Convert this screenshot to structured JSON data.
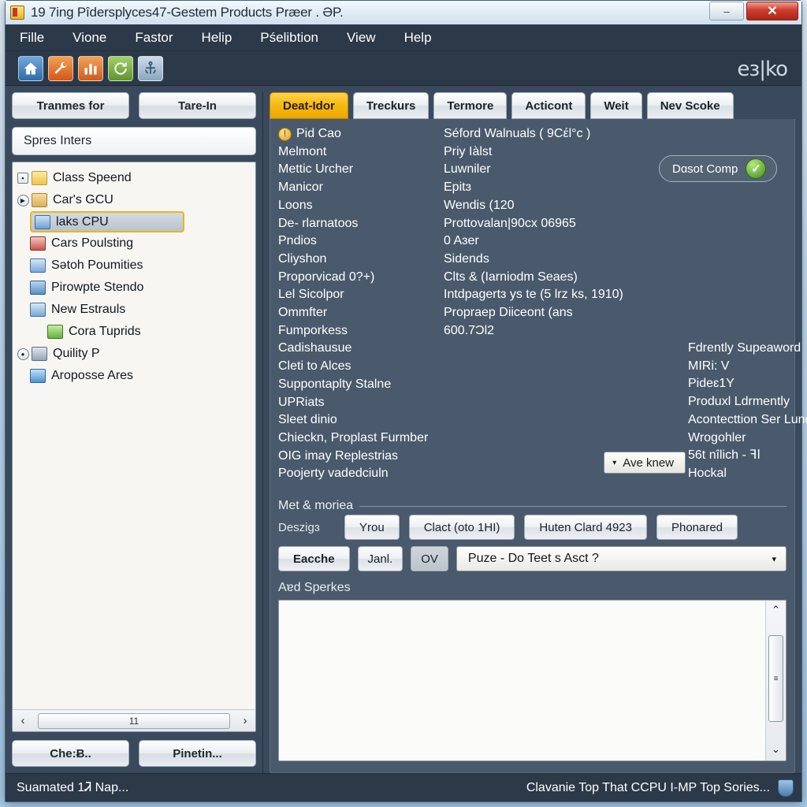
{
  "window": {
    "title": "19 7ing Pîdersplyces47-Gestem Products Præer . ƏP.",
    "minimize_label": "–",
    "maximize_label": "❐",
    "close_label": "✕"
  },
  "menubar": {
    "items": [
      {
        "label": "Fille"
      },
      {
        "label": "Vione"
      },
      {
        "label": "Fastor"
      },
      {
        "label": "Helip"
      },
      {
        "label": "Pśelibtion"
      },
      {
        "label": "View"
      },
      {
        "label": "Help"
      }
    ]
  },
  "toolbar": {
    "icons": [
      {
        "name": "home-icon",
        "glyph": "⌂"
      },
      {
        "name": "wrench-icon",
        "glyph": "🔧"
      },
      {
        "name": "chart-icon",
        "glyph": "📊"
      },
      {
        "name": "refresh-icon",
        "glyph": "↻"
      },
      {
        "name": "anchor-icon",
        "glyph": "⚓"
      }
    ],
    "brand": "eɜ|ko"
  },
  "left": {
    "top_buttons": [
      {
        "label": "Tranmes for"
      },
      {
        "label": "Tare-In"
      }
    ],
    "search": {
      "value": "Spres Inters",
      "placeholder": "Spres Inters"
    },
    "tree": [
      {
        "label": "Class Speend",
        "icon": "folder-icon",
        "twisty": "expanded",
        "indent": 0,
        "selected": false
      },
      {
        "label": "Car's GCU",
        "icon": "folder-open-icon",
        "twisty": "collapsed",
        "indent": 0,
        "selected": false
      },
      {
        "label": "laks CPU",
        "icon": "document-blue-icon",
        "twisty": "none",
        "indent": 1,
        "selected": true
      },
      {
        "label": "Cars Poulsting",
        "icon": "disc-red-icon",
        "twisty": "none",
        "indent": 1,
        "selected": false
      },
      {
        "label": "Sətoh Poumities",
        "icon": "document-blue-icon",
        "twisty": "none",
        "indent": 1,
        "selected": false
      },
      {
        "label": "Pirowpte Stendo",
        "icon": "plug-blue-icon",
        "twisty": "none",
        "indent": 1,
        "selected": false
      },
      {
        "label": "New Estrauls",
        "icon": "document-blue-icon",
        "twisty": "none",
        "indent": 1,
        "selected": false
      },
      {
        "label": "Cora Tuprids",
        "icon": "card-green-icon",
        "twisty": "none",
        "indent": 2,
        "selected": false
      },
      {
        "label": "Quility P",
        "icon": "gear-icon",
        "twisty": "radio",
        "indent": 0,
        "selected": false
      },
      {
        "label": "Aroposse Ares",
        "icon": "shield-icon",
        "twisty": "none",
        "indent": 1,
        "selected": false
      }
    ],
    "hscroll": {
      "left_arrow": "‹",
      "right_arrow": "›",
      "thumb_label": "11"
    },
    "bottom_buttons": [
      {
        "label": "Che:Ƀ.."
      },
      {
        "label": "Pinetin..."
      }
    ]
  },
  "tabs": [
    {
      "label": "Deat-Idor",
      "active": true
    },
    {
      "label": "Treckurs",
      "active": false
    },
    {
      "label": "Termore",
      "active": false
    },
    {
      "label": "Acticont",
      "active": false
    },
    {
      "label": "Weit",
      "active": false
    },
    {
      "label": "Nev Scoke",
      "active": false
    }
  ],
  "panel": {
    "column_a": [
      "Pid Cao",
      "Melmont",
      "Mettic Urcher",
      "Manicor",
      "Loons",
      "De- rlarnatoos",
      "Pndios",
      "Cliyshon",
      "Proporvicad 0?+)",
      "Lel Sicolpor",
      "Ommfter",
      "Fumporkess",
      "Cadishausue",
      "Cleti to Alces",
      "Suppontaplty Stalne",
      "UPRiats",
      "Sleet dinio",
      "Chieckn, Proplast Furmber",
      "OIG imay Replestrias",
      "Poojerty vadedciuln"
    ],
    "column_b": [
      "Séford Walnuals ( 9Cέl°c )",
      "Priy Iàlst",
      "Luwniler",
      "Epitɜ",
      "Wendis (120",
      "Prottovalan|90cx 06965",
      "0 Aɜer",
      "Sidends",
      "Clts &  (Iarniodm Seaes)",
      "Intdpagertɜ ys te (5 lrz ks, 1910)",
      "Propraep Diiceont (ans",
      "600.7ƆƖ2"
    ],
    "column_c": [
      "Fdrently Supeaword",
      "MIRi: V",
      "Pideɛ1Y",
      "Produxl Ldrmently",
      "Acontecttion Ser Lunozy",
      "Wrogohler",
      "56t nîlich - ꟻⅼ",
      "Hockal"
    ],
    "status_pill": {
      "label": "Dɑsot Comp",
      "icon": "check-circle-icon"
    },
    "inline_dropdown": {
      "label": "Ave knew",
      "caret": "▾"
    },
    "group": {
      "legend": "Met & moriea",
      "row1_label": "Deszigɜ",
      "row1_buttons": [
        {
          "label": "Yrou"
        },
        {
          "label": "Clact (oto 1HI)"
        },
        {
          "label": "Huten Clard 4923"
        },
        {
          "label": "Phonared"
        }
      ],
      "row2_buttons": [
        {
          "label": "Eacche"
        },
        {
          "label": "Janl."
        },
        {
          "label": "OV"
        }
      ],
      "combo": {
        "value": "Puze  -  Do Teet s Asct ?",
        "caret": "▾"
      }
    },
    "notes_label": "Aɐd Sperkes",
    "notes": {
      "value": "",
      "placeholder": ""
    },
    "notes_scroll": {
      "up": "⌃",
      "down": "⌄",
      "thumb": "≡"
    }
  },
  "statusbar": {
    "left": "Suamated 1Ꮨ Nap...",
    "right": "Clavanie Top That CCPU I-MP Top Sories...",
    "shield_icon": "shield-icon"
  },
  "colors": {
    "window_chrome": "#2b3949",
    "panel_bg": "#4a5a6c",
    "accent_tab": "#f5b913",
    "selection_border": "#e8b720",
    "close_button": "#cf3d2c",
    "ok_green": "#3e8b1f"
  }
}
